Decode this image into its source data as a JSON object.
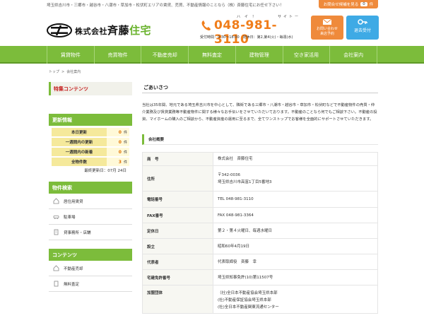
{
  "topbar": {
    "message": "埼玉県吉川市・三郷市・越谷市・八潮市・草加市・松伏町エリアの賃貸、売買、不動産情報のことなら（株）斉藤住宅にお任せ下さい！",
    "favorites_label": "お問合せ候補を見る",
    "favorites_count": "0",
    "favorites_unit": "件"
  },
  "header": {
    "logo_prefix": "株式会社",
    "logo_name_a": "斉藤",
    "logo_name_b": "住宅",
    "phone_kana_a": "ハイ！",
    "phone_kana_b": "サイトー",
    "phone_number": "048-981-3110",
    "hours": "受付時間：9:30〜18:00　定休日：第2,第4(火)・毎週(水)",
    "inquiry_line1": "お問い合わせ",
    "inquiry_line2": "来店予約",
    "visit_label": "退去受付"
  },
  "nav": {
    "items": [
      "賃貸物件",
      "売買物件",
      "不動産売却",
      "無料査定",
      "建物管理",
      "空き家活用",
      "会社案内"
    ]
  },
  "breadcrumb": {
    "home": "トップ",
    "sep": ">",
    "current": "会社案内"
  },
  "sidebar": {
    "feature_title": "特集コンテンツ",
    "update_title": "更新情報",
    "updates": [
      {
        "label": "本日更新",
        "count": "0",
        "unit": "件"
      },
      {
        "label": "一週間内の更新",
        "count": "0",
        "unit": "件"
      },
      {
        "label": "一週間内の新着",
        "count": "0",
        "unit": "件"
      },
      {
        "label": "全物件数",
        "count": "3",
        "unit": "件"
      }
    ],
    "last_update": "最終更新日：07月 24日",
    "search_title": "物件検索",
    "search_links": [
      "居住用賃貸",
      "駐車場",
      "貸事務所・店舗"
    ],
    "contents_title": "コンテンツ",
    "content_links": [
      "不動産売却",
      "無料査定"
    ]
  },
  "main": {
    "greeting_title": "ごあいさつ",
    "greeting_body": "当社は35年間、地元である埼玉県吉川市を中心として、隣街である三郷市・八潮市・越谷市・草加市・松伏町などで不動産物件の売買・仲介業務及び賃貸業務等不動産物件に関する様々なお手伝いをさせていただいております。不動産のことなら何でもご相談下さい。不動産の投資、マイホームの購入のご相談から、不動産資産の運用に至るまで、全てワンストップでお客様を全面的にサポートさせていただきます。",
    "outline_title": "会社概要",
    "outline": [
      {
        "key": "商　号",
        "value": [
          "株式会社　斉藤住宅"
        ]
      },
      {
        "key": "住所",
        "value": [
          "〒342-0036",
          "埼玉県吉川市高富1丁目5番地3"
        ]
      },
      {
        "key": "電話番号",
        "value": [
          "TEL 048-981-3110"
        ]
      },
      {
        "key": "FAX番号",
        "value": [
          "FAX 048-981-3364"
        ]
      },
      {
        "key": "定休日",
        "value": [
          "第２・第４火曜日、毎週水曜日"
        ]
      },
      {
        "key": "設立",
        "value": [
          "昭和60年4月19日"
        ]
      },
      {
        "key": "代表者",
        "value": [
          "代表取締役　斉藤　幸"
        ]
      },
      {
        "key": "宅建免許番号",
        "value": [
          "埼玉県知事免許(10)第11507号"
        ]
      },
      {
        "key": "加盟団体",
        "value": [
          "（社)全日本不動産協会埼玉県本部",
          "(社)不動産保証協会埼玉県本部",
          "(社)全日本不動産関東流通センター"
        ]
      }
    ]
  },
  "colors": {
    "green": "#7cbc3b",
    "orange": "#ef8a3b",
    "blue": "#3eaae5",
    "red": "#c51d1d"
  }
}
